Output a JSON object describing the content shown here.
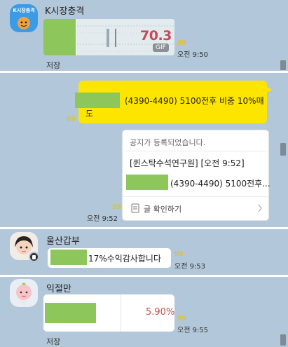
{
  "messages": {
    "m1": {
      "sender": "K시장충격",
      "avatar_text": "K시장충격",
      "gif_value": "70.3",
      "gif_badge": "GIF",
      "read": "99",
      "time": "오전 9:50",
      "save": "저장"
    },
    "m2": {
      "text_line1": "(4390-4490) 5100전후 비중 10%매",
      "text_line2": "도",
      "read": "99"
    },
    "m3": {
      "header": "공지가 등록되었습니다.",
      "author": "[퀸스탁수석연구원] [오전 9:52]",
      "preview": "(4390-4490) 5100전후...",
      "action": "글 확인하기",
      "read": "99",
      "time": "오전 9:52"
    },
    "m4": {
      "sender": "울산갑부",
      "text": "17%수익감사합니다",
      "read": "99",
      "time": "오전 9:53"
    },
    "m5": {
      "sender": "익절만",
      "value": "5.90%",
      "read": "99",
      "time": "오전 9:55",
      "save": "저장"
    }
  },
  "icons": {
    "doc": "document-icon",
    "chevron": "chevron-right-icon",
    "mobile": "mobile-badge-icon"
  },
  "colors": {
    "background": "#b2c7d9",
    "my_bubble": "#fee500",
    "read_count": "#e8c10a",
    "value_red": "#c0504d"
  }
}
